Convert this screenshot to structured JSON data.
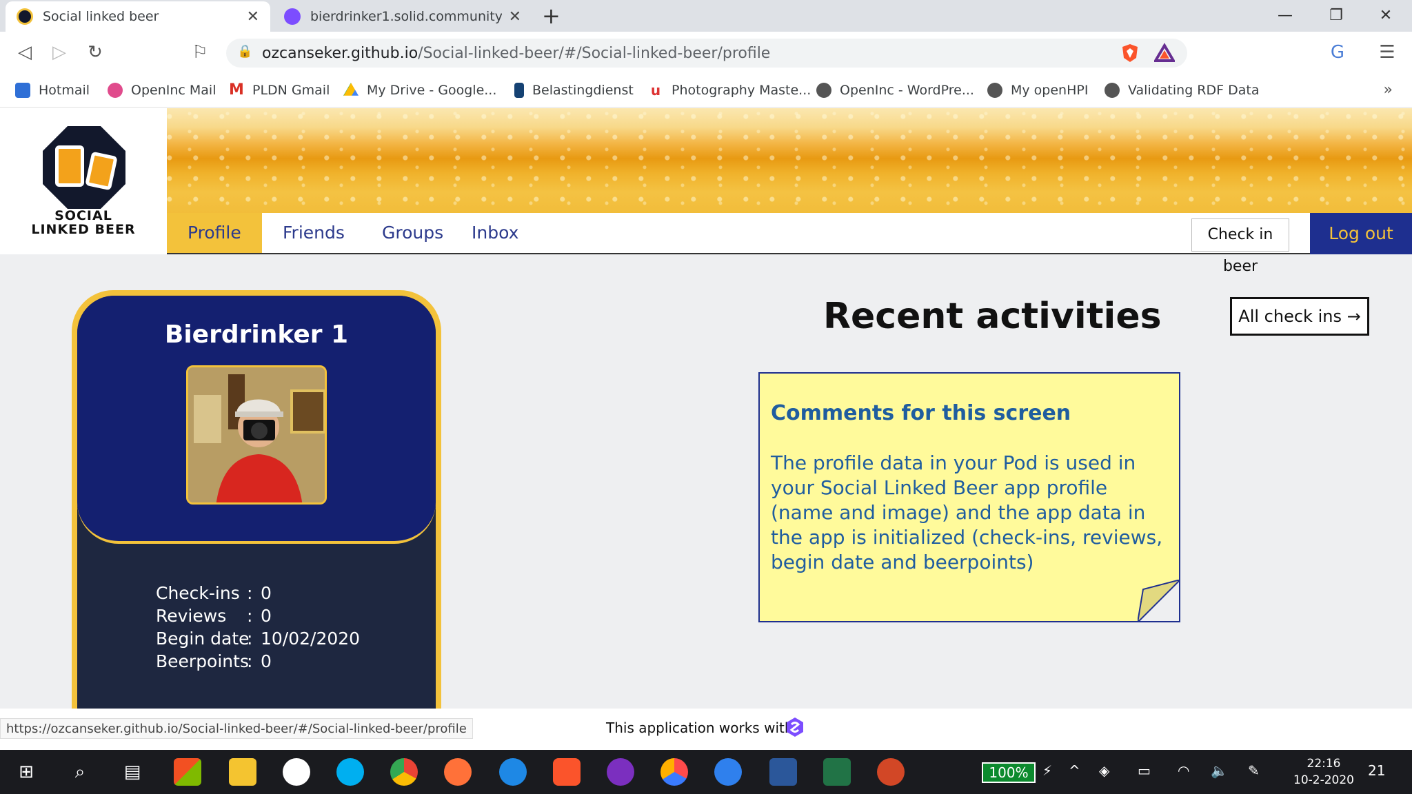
{
  "browser": {
    "tabs": [
      {
        "title": "Social linked beer",
        "active": true
      },
      {
        "title": "bierdrinker1.solid.community",
        "active": false
      }
    ],
    "new_tab_glyph": "+",
    "url_host": "ozcanseker.github.io",
    "url_path": "/Social-linked-beer/#/Social-linked-beer/profile",
    "bookmarks": [
      "Hotmail",
      "OpenInc Mail",
      "PLDN Gmail",
      "My Drive - Google...",
      "Belastingdienst",
      "Photography Maste...",
      "OpenInc - WordPre...",
      "My openHPI",
      "Validating RDF Data"
    ],
    "bookmarks_more": "»"
  },
  "app": {
    "logo_line1": "SOCIAL",
    "logo_line2": "LINKED BEER",
    "nav": {
      "profile": "Profile",
      "friends": "Friends",
      "groups": "Groups",
      "inbox": "Inbox",
      "check_in": "Check in beer",
      "logout": "Log out"
    },
    "profile": {
      "name": "Bierdrinker 1",
      "stats": [
        {
          "label": "Check-ins",
          "sep": ":",
          "value": "0"
        },
        {
          "label": "Reviews",
          "sep": ":",
          "value": "0"
        },
        {
          "label": "Begin date",
          "sep": ":",
          "value": "10/02/2020"
        },
        {
          "label": "Beerpoints",
          "sep": ":",
          "value": "0"
        }
      ]
    },
    "recent_title": "Recent activities",
    "all_checkins": "All check ins →",
    "note": {
      "title": "Comments for this screen",
      "body": "The profile data in your Pod is used in your Social Linked Beer app profile (name and image) and the app data in the app is initialized (check-ins, reviews, begin date and beerpoints)"
    },
    "footer_text": "This application works with"
  },
  "status_url": "https://ozcanseker.github.io/Social-linked-beer/#/Social-linked-beer/profile",
  "taskbar": {
    "battery": "100%",
    "time": "22:16",
    "date": "10-2-2020",
    "notifications": "21"
  },
  "colors": {
    "navy": "#142070",
    "gold": "#f3c23b",
    "note_yellow": "#fffa9b",
    "note_text": "#1f5d9f"
  }
}
